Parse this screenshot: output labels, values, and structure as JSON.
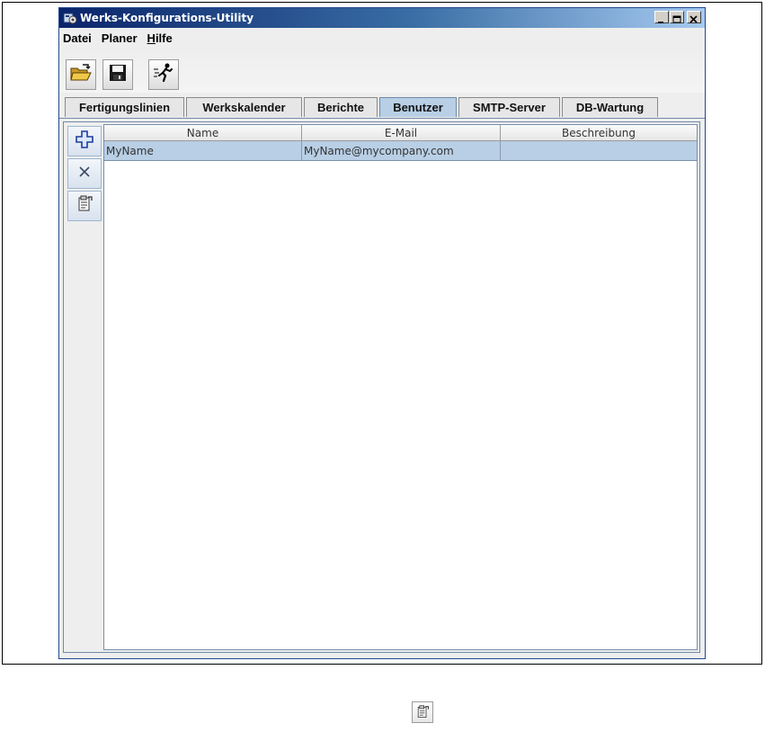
{
  "window": {
    "title": "Werks-Konfigurations-Utility",
    "icon": "app-gear-icon",
    "controls": [
      "minimize-icon",
      "maximize-icon",
      "close-icon"
    ]
  },
  "menubar": {
    "items": [
      {
        "label": "Datei"
      },
      {
        "label": "Planer"
      },
      {
        "label": "Hilfe"
      }
    ]
  },
  "toolbar": {
    "buttons": [
      {
        "icon": "open-folder-icon"
      },
      {
        "icon": "save-disk-icon"
      },
      {
        "icon": "exit-runner-icon"
      }
    ]
  },
  "tabs": [
    {
      "label": "Fertigungslinien"
    },
    {
      "label": "Werkskalender"
    },
    {
      "label": "Berichte"
    },
    {
      "label": "Benutzer",
      "active": true
    },
    {
      "label": "SMTP-Server"
    },
    {
      "label": "DB-Wartung"
    }
  ],
  "side_toolbar": {
    "buttons": [
      {
        "icon": "add-plus-icon"
      },
      {
        "icon": "delete-x-icon"
      },
      {
        "icon": "properties-icon"
      }
    ]
  },
  "table": {
    "columns": [
      "Name",
      "E-Mail",
      "Beschreibung"
    ],
    "rows": [
      {
        "name": "MyName",
        "email": "MyName@mycompany.com",
        "description": ""
      }
    ],
    "selected_row_color": "#b8cfe5"
  },
  "colors": {
    "titlebar_start": "#0a246a",
    "titlebar_end": "#a6caf0",
    "active_tab": "#b8cfe5"
  },
  "floating_icon": "properties-icon"
}
